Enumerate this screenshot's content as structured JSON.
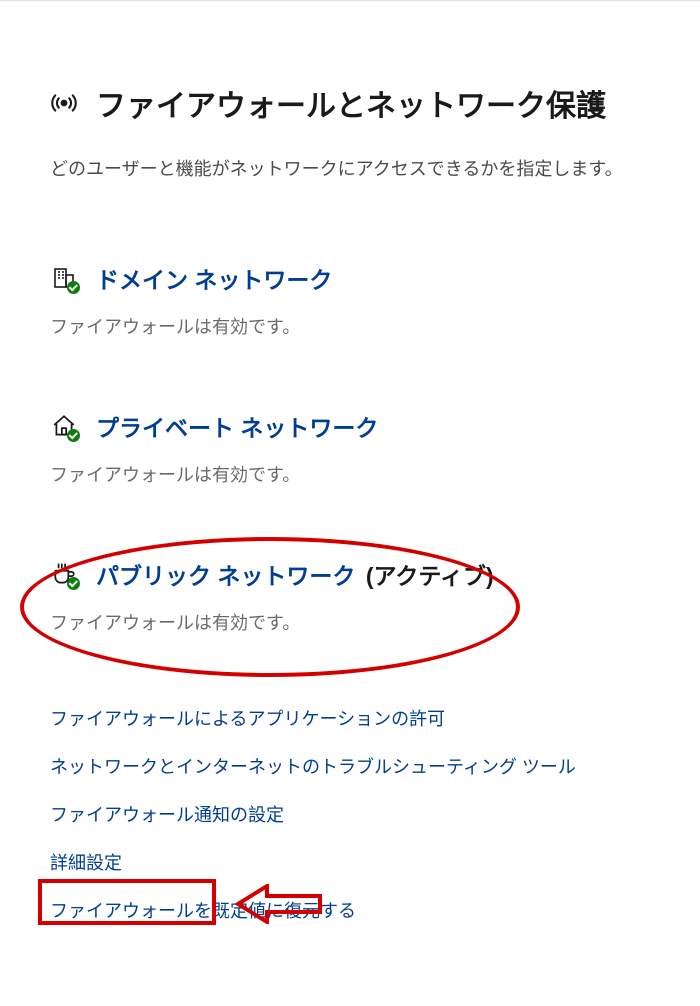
{
  "page": {
    "title": "ファイアウォールとネットワーク保護",
    "subtitle": "どのユーザーと機能がネットワークにアクセスできるかを指定します。"
  },
  "networks": [
    {
      "label": "ドメイン ネットワーク",
      "status": "ファイアウォールは有効です。",
      "active": ""
    },
    {
      "label": "プライベート ネットワーク",
      "status": "ファイアウォールは有効です。",
      "active": ""
    },
    {
      "label": "パブリック ネットワーク",
      "status": "ファイアウォールは有効です。",
      "active": "(アクティブ)"
    }
  ],
  "links": [
    "ファイアウォールによるアプリケーションの許可",
    "ネットワークとインターネットのトラブルシューティング ツール",
    "ファイアウォール通知の設定",
    "詳細設定",
    "ファイアウォールを既定値に復元する"
  ]
}
